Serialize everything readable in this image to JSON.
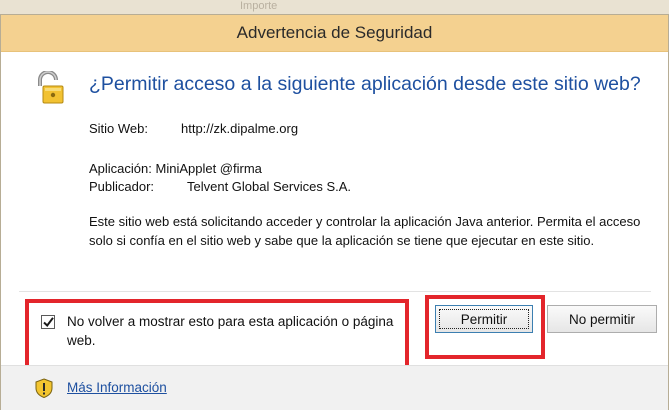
{
  "window": {
    "title": "Advertencia de Seguridad"
  },
  "background_text": "Importe",
  "headline": "¿Permitir acceso a la siguiente aplicación desde este sitio web?",
  "details": {
    "site_label": "Sitio Web:",
    "site_value": "http://zk.dipalme.org",
    "app_label": "Aplicación:",
    "app_value": "MiniApplet @firma",
    "publisher_label": "Publicador:",
    "publisher_value": "Telvent Global Services S.A.",
    "message": "Este sitio web está solicitando acceder y controlar la aplicación Java anterior. Permita el acceso solo si confía en el sitio web y sabe que la aplicación se tiene que ejecutar en este sitio."
  },
  "options": {
    "dont_show_again_label": "No volver a mostrar esto para esta aplicación o página web.",
    "dont_show_again_checked": true
  },
  "buttons": {
    "allow_label": "Permitir",
    "deny_label": "No permitir"
  },
  "footer": {
    "more_info_label": "Más Información"
  },
  "colors": {
    "title_bar": "#f4d190",
    "headline": "#1e50a0",
    "highlight": "#e3252b"
  },
  "icons": {
    "header": "lock-icon",
    "footer": "shield-warning-icon",
    "checkbox": "checkmark-icon"
  }
}
